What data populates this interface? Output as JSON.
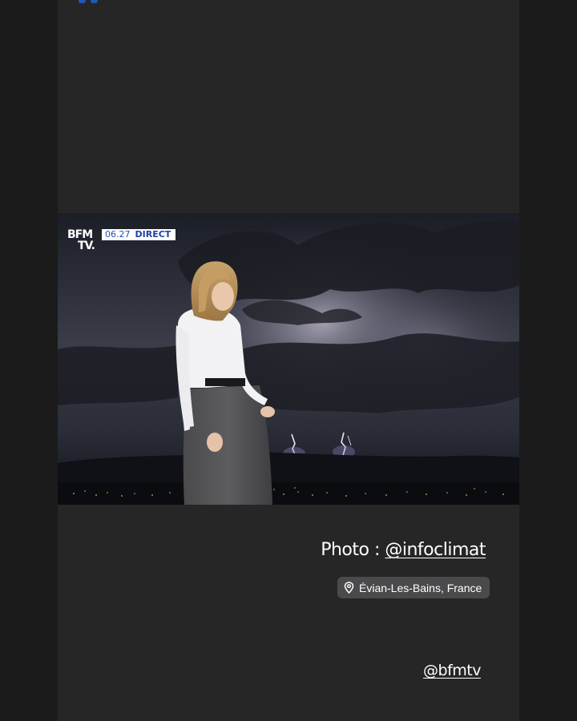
{
  "video": {
    "channel_logo_line1": "BFM",
    "channel_logo_line2": "TV.",
    "live_time": "06.27",
    "live_label": "DIRECT"
  },
  "credit": {
    "prefix": "Photo : ",
    "handle": "@infoclimat"
  },
  "location": {
    "icon": "location-pin-icon",
    "label": "Évian-Les-Bains, France"
  },
  "mention": {
    "handle": "@bfmtv"
  },
  "colors": {
    "page_bg": "#1b1b1b",
    "story_bg": "#262627",
    "pill_bg": "#4a4a4c",
    "brand_blue": "#1f3ea8",
    "text": "#ffffff"
  }
}
